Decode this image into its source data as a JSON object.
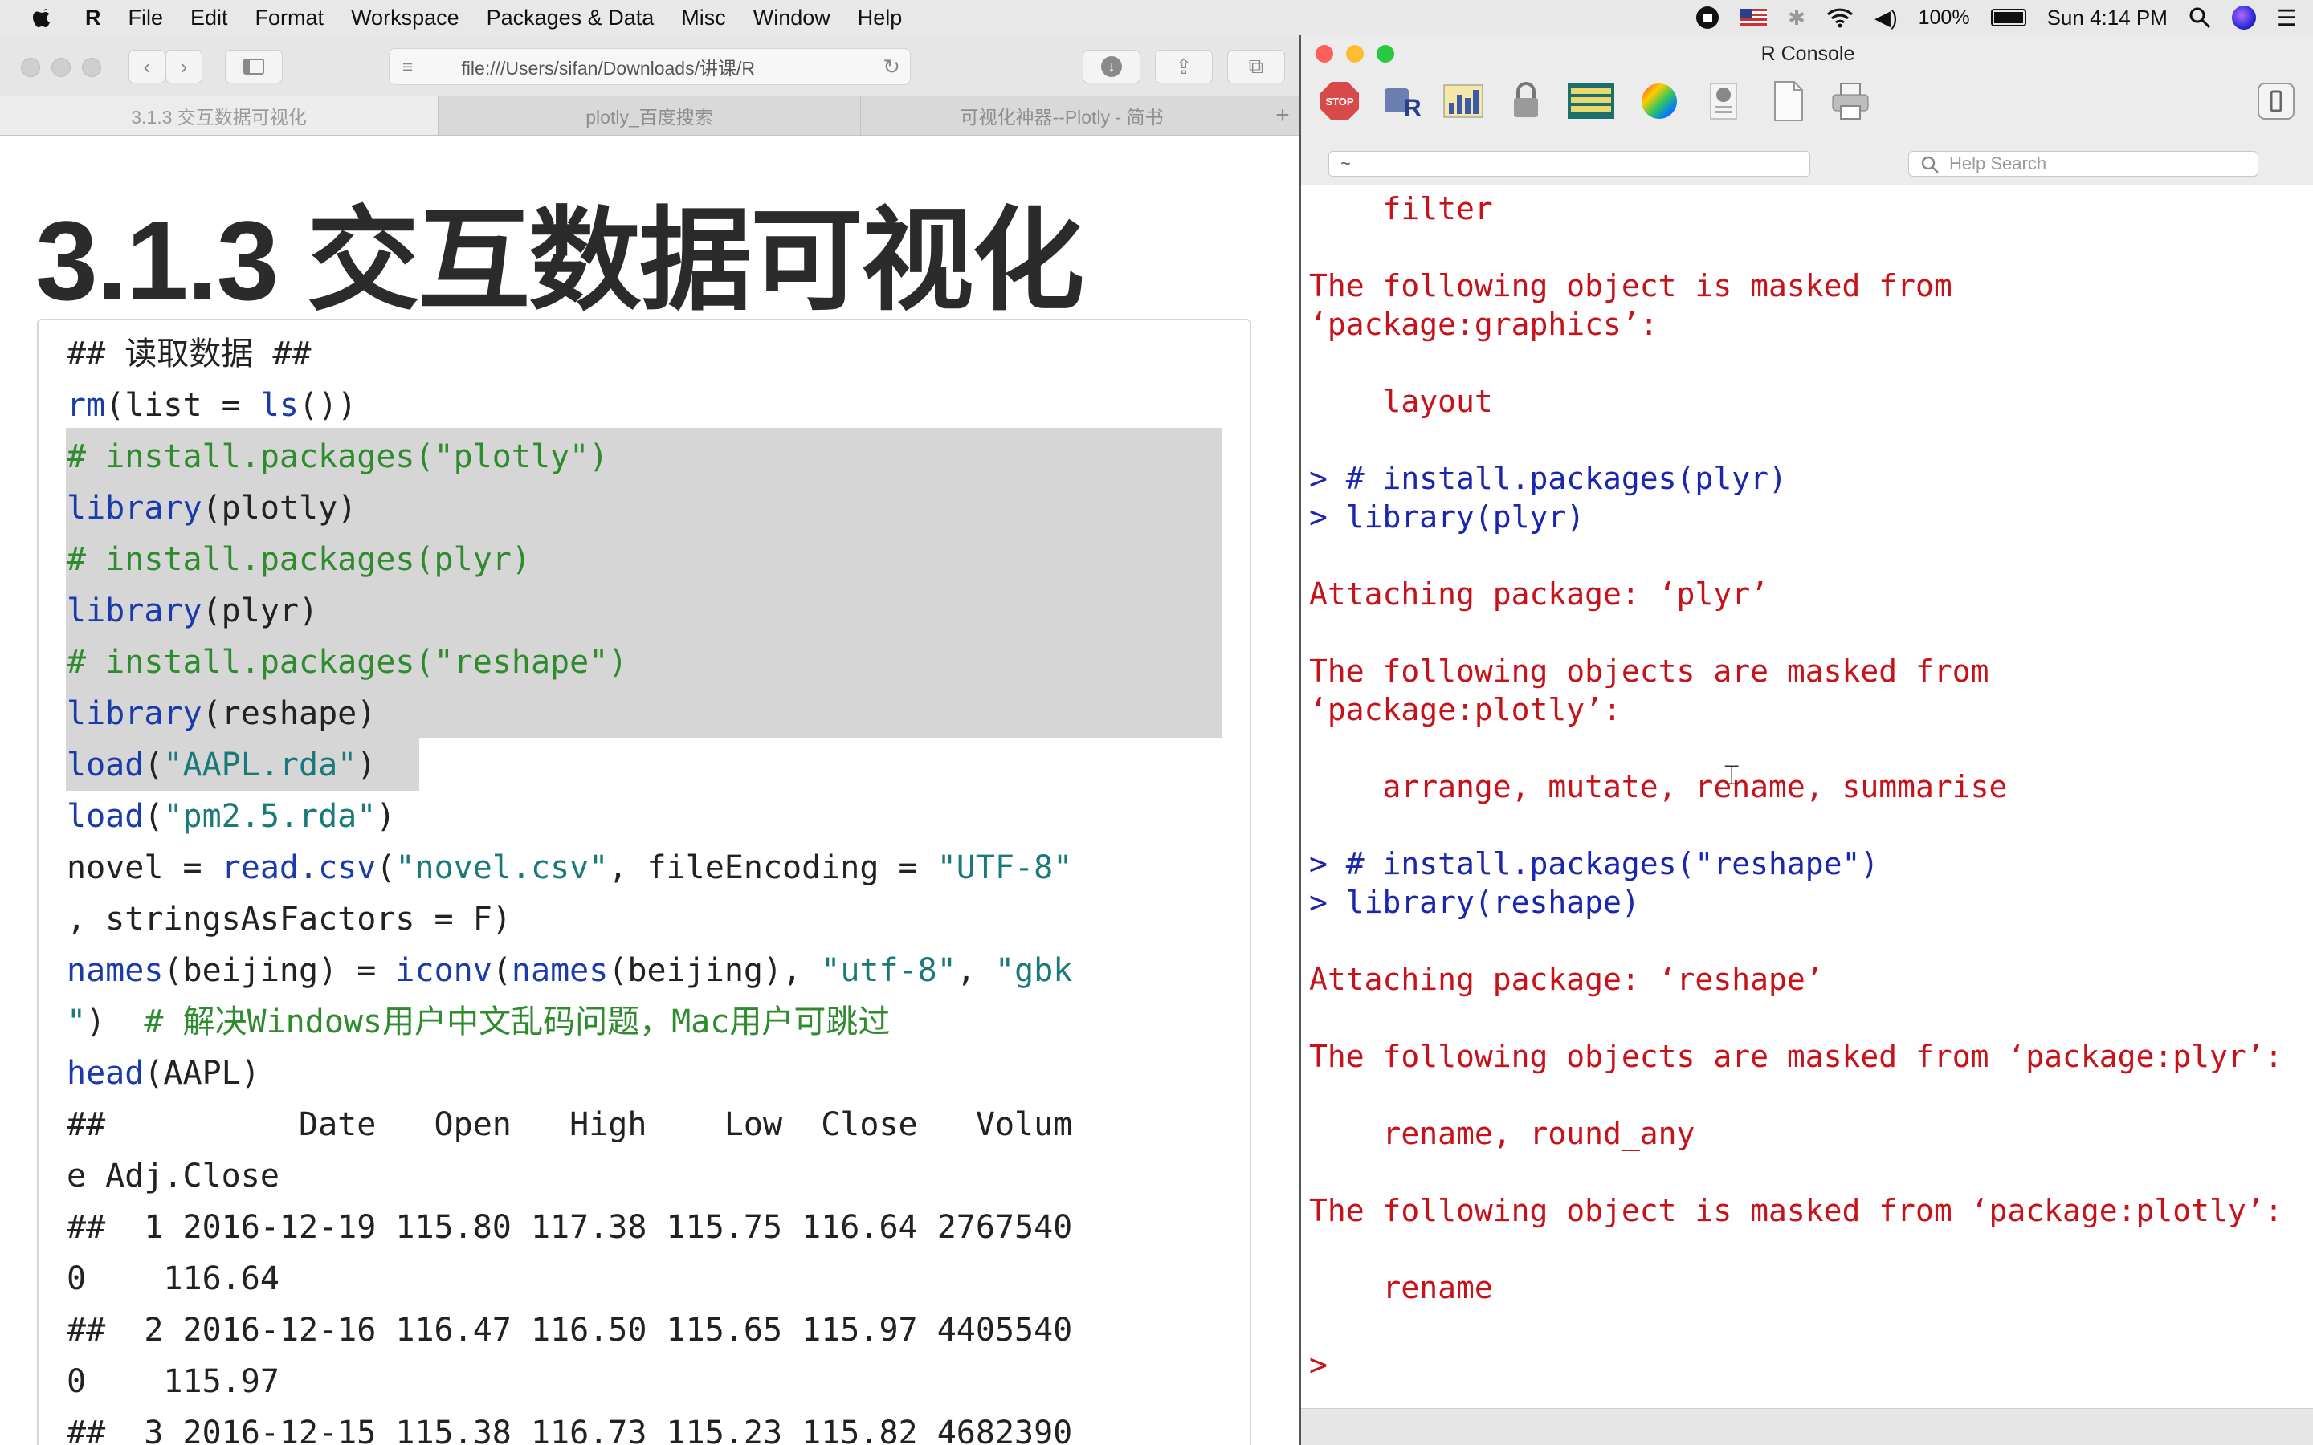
{
  "menubar": {
    "items": [
      "R",
      "File",
      "Edit",
      "Format",
      "Workspace",
      "Packages & Data",
      "Misc",
      "Window",
      "Help"
    ],
    "battery": "100%",
    "clock": "Sun 4:14 PM"
  },
  "safari": {
    "url": "file:///Users/sifan/Downloads/讲课/R",
    "tabs": [
      "3.1.3 交互数据可视化",
      "plotly_百度搜索",
      "可视化神器--Plotly - 简书"
    ],
    "new_tab": "+",
    "heading": "3.1.3 交互数据可视化",
    "code_lines": [
      [
        {
          "t": "## 读取数据 ##",
          "c": ""
        }
      ],
      [
        {
          "t": "rm",
          "c": "k"
        },
        {
          "t": "(list = ",
          "c": ""
        },
        {
          "t": "ls",
          "c": "k"
        },
        {
          "t": "())",
          "c": ""
        }
      ],
      [
        {
          "t": "# install.packages(\"plotly\")",
          "c": "c"
        }
      ],
      [
        {
          "t": "library",
          "c": "k"
        },
        {
          "t": "(plotly)",
          "c": ""
        }
      ],
      [
        {
          "t": "# install.packages(plyr)",
          "c": "c"
        }
      ],
      [
        {
          "t": "library",
          "c": "k"
        },
        {
          "t": "(plyr)",
          "c": ""
        }
      ],
      [
        {
          "t": "# install.packages(\"reshape\")",
          "c": "c"
        }
      ],
      [
        {
          "t": "library",
          "c": "k"
        },
        {
          "t": "(reshape)",
          "c": ""
        }
      ],
      [
        {
          "t": "load",
          "c": "k"
        },
        {
          "t": "(",
          "c": ""
        },
        {
          "t": "\"AAPL.rda\"",
          "c": "s"
        },
        {
          "t": ")",
          "c": ""
        }
      ],
      [
        {
          "t": "load",
          "c": "k"
        },
        {
          "t": "(",
          "c": ""
        },
        {
          "t": "\"pm2.5.rda\"",
          "c": "s"
        },
        {
          "t": ")",
          "c": ""
        }
      ],
      [
        {
          "t": "novel = ",
          "c": ""
        },
        {
          "t": "read.csv",
          "c": "k"
        },
        {
          "t": "(",
          "c": ""
        },
        {
          "t": "\"novel.csv\"",
          "c": "s"
        },
        {
          "t": ", fileEncoding = ",
          "c": ""
        },
        {
          "t": "\"UTF-8\"",
          "c": "s"
        }
      ],
      [
        {
          "t": ", stringsAsFactors = F)",
          "c": ""
        }
      ],
      [
        {
          "t": "names",
          "c": "k"
        },
        {
          "t": "(beijing) = ",
          "c": ""
        },
        {
          "t": "iconv",
          "c": "k"
        },
        {
          "t": "(",
          "c": ""
        },
        {
          "t": "names",
          "c": "k"
        },
        {
          "t": "(beijing), ",
          "c": ""
        },
        {
          "t": "\"utf-8\"",
          "c": "s"
        },
        {
          "t": ", ",
          "c": ""
        },
        {
          "t": "\"gbk",
          "c": "s"
        }
      ],
      [
        {
          "t": "\"",
          "c": "s"
        },
        {
          "t": ")  ",
          "c": ""
        },
        {
          "t": "# 解决Windows用户中文乱码问题，Mac用户可跳过",
          "c": "c"
        }
      ],
      [
        {
          "t": "head",
          "c": "k"
        },
        {
          "t": "(AAPL)",
          "c": ""
        }
      ],
      [
        {
          "t": "##          Date   Open   High    Low  Close   Volum",
          "c": ""
        }
      ],
      [
        {
          "t": "e Adj.Close",
          "c": ""
        }
      ],
      [
        {
          "t": "##  1 2016-12-19 115.80 117.38 115.75 116.64 2767540",
          "c": ""
        }
      ],
      [
        {
          "t": "0    116.64",
          "c": ""
        }
      ],
      [
        {
          "t": "##  2 2016-12-16 116.47 116.50 115.65 115.97 4405540",
          "c": ""
        }
      ],
      [
        {
          "t": "0    115.97",
          "c": ""
        }
      ],
      [
        {
          "t": "##  3 2016-12-15 115.38 116.73 115.23 115.82 4682390",
          "c": ""
        }
      ]
    ]
  },
  "rconsole": {
    "title": "R Console",
    "path": "~",
    "help_placeholder": "Help Search",
    "lines": [
      {
        "t": "    filter",
        "c": "red"
      },
      {
        "t": "",
        "c": "red"
      },
      {
        "t": "The following object is masked from",
        "c": "red"
      },
      {
        "t": "‘package:graphics’:",
        "c": "red"
      },
      {
        "t": "",
        "c": "red"
      },
      {
        "t": "    layout",
        "c": "red"
      },
      {
        "t": "",
        "c": "red"
      },
      {
        "t": "> # install.packages(plyr)",
        "c": "blue"
      },
      {
        "t": "> library(plyr)",
        "c": "blue"
      },
      {
        "t": "",
        "c": "red"
      },
      {
        "t": "Attaching package: ‘plyr’",
        "c": "red"
      },
      {
        "t": "",
        "c": "red"
      },
      {
        "t": "The following objects are masked from",
        "c": "red"
      },
      {
        "t": "‘package:plotly’:",
        "c": "red"
      },
      {
        "t": "",
        "c": "red"
      },
      {
        "t": "    arrange, mutate, rename, summarise",
        "c": "red"
      },
      {
        "t": "",
        "c": "red"
      },
      {
        "t": "> # install.packages(\"reshape\")",
        "c": "blue"
      },
      {
        "t": "> library(reshape)",
        "c": "blue"
      },
      {
        "t": "",
        "c": "red"
      },
      {
        "t": "Attaching package: ‘reshape’",
        "c": "red"
      },
      {
        "t": "",
        "c": "red"
      },
      {
        "t": "The following objects are masked from ‘package:plyr’:",
        "c": "red"
      },
      {
        "t": "",
        "c": "red"
      },
      {
        "t": "    rename, round_any",
        "c": "red"
      },
      {
        "t": "",
        "c": "red"
      },
      {
        "t": "The following object is masked from ‘package:plotly’:",
        "c": "red"
      },
      {
        "t": "",
        "c": "red"
      },
      {
        "t": "    rename",
        "c": "red"
      },
      {
        "t": "",
        "c": "red"
      },
      {
        "t": ">",
        "c": "red"
      }
    ]
  }
}
